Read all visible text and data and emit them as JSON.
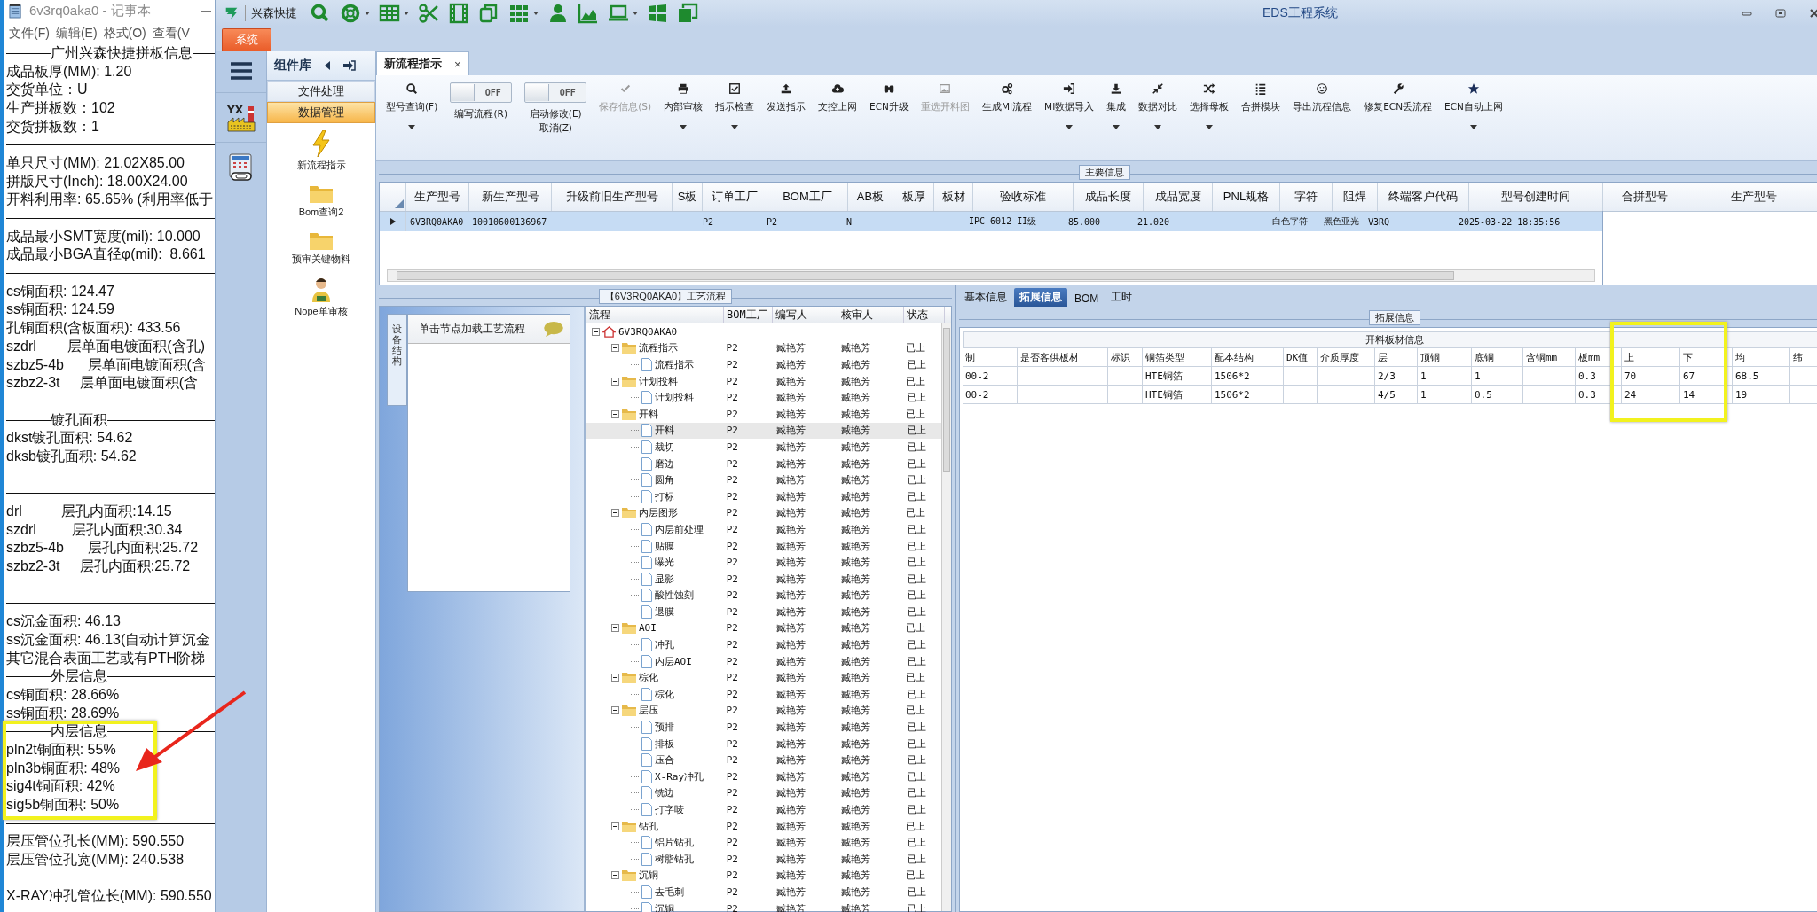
{
  "notepad": {
    "title": "6v3rq0aka0 - 记事本",
    "menu": [
      "文件(F)",
      "编辑(E)",
      "格式(O)",
      "查看(V"
    ],
    "lines": [
      {
        "kind": "rule",
        "text": "广州兴森快捷拼板信息"
      },
      {
        "kind": "text",
        "text": "成品板厚(MM): 1.20"
      },
      {
        "kind": "text",
        "text": "交货单位：U"
      },
      {
        "kind": "text",
        "text": "生产拼板数：102"
      },
      {
        "kind": "text",
        "text": "交货拼板数：1"
      },
      {
        "kind": "rule"
      },
      {
        "kind": "text",
        "text": "单只尺寸(MM): 21.02X85.00"
      },
      {
        "kind": "text",
        "text": "拼版尺寸(Inch): 18.00X24.00"
      },
      {
        "kind": "text",
        "text": "开料利用率: 65.65% (利用率低于"
      },
      {
        "kind": "rule"
      },
      {
        "kind": "text",
        "text": "成品最小SMT宽度(mil): 10.000"
      },
      {
        "kind": "text",
        "text": "成品最小BGA直径φ(mil):  8.661"
      },
      {
        "kind": "rule"
      },
      {
        "kind": "text",
        "text": "cs铜面积: 124.47"
      },
      {
        "kind": "text",
        "text": "ss铜面积: 124.59"
      },
      {
        "kind": "text",
        "text": "孔铜面积(含板面积): 433.56"
      },
      {
        "kind": "text",
        "text": "szdrl        层单面电镀面积(含孔)"
      },
      {
        "kind": "text",
        "text": "szbz5-4b      层单面电镀面积(含"
      },
      {
        "kind": "text",
        "text": "szbz2-3t     层单面电镀面积(含"
      },
      {
        "kind": "blank"
      },
      {
        "kind": "rule",
        "text": "镀孔面积"
      },
      {
        "kind": "text",
        "text": "dkst镀孔面积: 54.62"
      },
      {
        "kind": "text",
        "text": "dksb镀孔面积: 54.62"
      },
      {
        "kind": "blank"
      },
      {
        "kind": "rule"
      },
      {
        "kind": "text",
        "text": "drl          层孔内面积:14.15"
      },
      {
        "kind": "text",
        "text": "szdrl         层孔内面积:30.34"
      },
      {
        "kind": "text",
        "text": "szbz5-4b      层孔内面积:25.72"
      },
      {
        "kind": "text",
        "text": "szbz2-3t     层孔内面积:25.72"
      },
      {
        "kind": "blank"
      },
      {
        "kind": "rule"
      },
      {
        "kind": "text",
        "text": "cs沉金面积: 46.13"
      },
      {
        "kind": "text",
        "text": "ss沉金面积: 46.13(自动计算沉金"
      },
      {
        "kind": "text",
        "text": "其它混合表面工艺或有PTH阶梯"
      },
      {
        "kind": "rule",
        "text": "外层信息"
      },
      {
        "kind": "text",
        "text": "cs铜面积: 28.66%"
      },
      {
        "kind": "text",
        "text": "ss铜面积: 28.69%"
      },
      {
        "kind": "rule",
        "text": "内层信息"
      },
      {
        "kind": "text",
        "text": "pln2t铜面积: 55%"
      },
      {
        "kind": "text",
        "text": "pln3b铜面积: 48%"
      },
      {
        "kind": "text",
        "text": "sig4t铜面积: 42%"
      },
      {
        "kind": "text",
        "text": "sig5b铜面积: 50%"
      },
      {
        "kind": "rule"
      },
      {
        "kind": "text",
        "text": "层压管位孔长(MM): 590.550"
      },
      {
        "kind": "text",
        "text": "层压管位孔宽(MM): 240.538"
      },
      {
        "kind": "blank"
      },
      {
        "kind": "text",
        "text": "X-RAY冲孔管位长(MM): 590.550"
      }
    ]
  },
  "window": {
    "title": "EDS工程系统",
    "app_name": "兴森快捷",
    "menu_tab": "系统"
  },
  "side_strip": {
    "factory_label": "YX"
  },
  "component_library": {
    "title": "组件库",
    "sections": [
      {
        "label": "文件处理",
        "selected": false
      },
      {
        "label": "数据管理",
        "selected": true
      }
    ],
    "items": [
      "新流程指示",
      "Bom查询2",
      "预审关键物料",
      "Nope单审核"
    ]
  },
  "document_tab": {
    "label": "新流程指示",
    "close": "×"
  },
  "toolbar": [
    {
      "kind": "button",
      "label": "型号查询(F)",
      "disabled": false,
      "dropdown": true
    },
    {
      "kind": "toggle",
      "label": "编写流程(R)",
      "on": false,
      "state_text": "OFF"
    },
    {
      "kind": "toggle",
      "label": "启动修改(E)\n取消(Z)",
      "on": false,
      "state_text": "OFF"
    },
    {
      "kind": "button",
      "label": "保存信息(S)",
      "disabled": true,
      "dropdown": false
    },
    {
      "kind": "button",
      "label": "内部审核",
      "disabled": false,
      "dropdown": true
    },
    {
      "kind": "button",
      "label": "指示检查",
      "disabled": false,
      "dropdown": true
    },
    {
      "kind": "button",
      "label": "发送指示",
      "disabled": false,
      "dropdown": false
    },
    {
      "kind": "button",
      "label": "文控上网",
      "disabled": false,
      "dropdown": false
    },
    {
      "kind": "button",
      "label": "ECN升级",
      "disabled": false,
      "dropdown": false
    },
    {
      "kind": "button",
      "label": "重选开料图",
      "disabled": true,
      "dropdown": false
    },
    {
      "kind": "button",
      "label": "生成MI流程",
      "disabled": false,
      "dropdown": false
    },
    {
      "kind": "button",
      "label": "MI数据导入",
      "disabled": false,
      "dropdown": true
    },
    {
      "kind": "button",
      "label": "集成",
      "disabled": false,
      "dropdown": true
    },
    {
      "kind": "button",
      "label": "数据对比",
      "disabled": false,
      "dropdown": true
    },
    {
      "kind": "button",
      "label": "选择母板",
      "disabled": false,
      "dropdown": true
    },
    {
      "kind": "button",
      "label": "合拼模块",
      "disabled": false,
      "dropdown": false
    },
    {
      "kind": "button",
      "label": "导出流程信息",
      "disabled": false,
      "dropdown": false
    },
    {
      "kind": "button",
      "label": "修复ECN丢流程",
      "disabled": false,
      "dropdown": false
    },
    {
      "kind": "button",
      "label": "ECN自动上网",
      "disabled": false,
      "dropdown": true
    }
  ],
  "main_info": {
    "title": "主要信息",
    "columns": [
      "生产型号",
      "新生产型号",
      "升级前旧生产型号",
      "S板",
      "订单工厂",
      "BOM工厂",
      "AB板",
      "板厚",
      "板材",
      "验收标准",
      "成品长度",
      "成品宽度",
      "PNL规格",
      "字符",
      "阻焊",
      "终端客户代码",
      "型号创建时间"
    ],
    "rows": [
      {
        "selected": true,
        "cells": [
          "6V3RQ0AKA0",
          "10010600136967",
          "",
          "",
          "P2",
          "P2",
          "N",
          "",
          "",
          "IPC-6012 II级",
          "85.000",
          "21.020",
          "",
          "白色字符",
          "黑色亚光",
          "V3RQ",
          "2025-03-22 18:35:56"
        ]
      }
    ],
    "side_columns": [
      "合拼型号",
      "生产型号"
    ]
  },
  "process": {
    "title": "【6V3RQ0AKA0】工艺流程",
    "side_tab": "设备结构",
    "hint": "单击节点加载工艺流程",
    "columns": [
      "流程",
      "BOM工厂",
      "编写人",
      "核审人",
      "状态"
    ],
    "tree": [
      {
        "label": "6V3RQ0AKA0",
        "kind": "root",
        "expanded": true,
        "selected": false,
        "children": [
          {
            "label": "流程指示",
            "kind": "group",
            "expanded": true,
            "selected": false,
            "bom": "P2",
            "writer": "臧艳芳",
            "reviewer": "臧艳芳",
            "status": "已上",
            "children": [
              {
                "label": "流程指示",
                "kind": "step",
                "selected": false,
                "bom": "P2",
                "writer": "臧艳芳",
                "reviewer": "臧艳芳",
                "status": "已上"
              }
            ]
          },
          {
            "label": "计划投料",
            "kind": "group",
            "expanded": true,
            "selected": false,
            "bom": "P2",
            "writer": "臧艳芳",
            "reviewer": "臧艳芳",
            "status": "已上",
            "children": [
              {
                "label": "计划投料",
                "kind": "step",
                "selected": false,
                "bom": "P2",
                "writer": "臧艳芳",
                "reviewer": "臧艳芳",
                "status": "已上"
              }
            ]
          },
          {
            "label": "开料",
            "kind": "group",
            "expanded": true,
            "selected": false,
            "bom": "P2",
            "writer": "臧艳芳",
            "reviewer": "臧艳芳",
            "status": "已上",
            "children": [
              {
                "label": "开料",
                "kind": "step",
                "selected": true,
                "bom": "P2",
                "writer": "臧艳芳",
                "reviewer": "臧艳芳",
                "status": "已上"
              },
              {
                "label": "裁切",
                "kind": "step",
                "selected": false,
                "bom": "P2",
                "writer": "臧艳芳",
                "reviewer": "臧艳芳",
                "status": "已上"
              },
              {
                "label": "磨边",
                "kind": "step",
                "selected": false,
                "bom": "P2",
                "writer": "臧艳芳",
                "reviewer": "臧艳芳",
                "status": "已上"
              },
              {
                "label": "圆角",
                "kind": "step",
                "selected": false,
                "bom": "P2",
                "writer": "臧艳芳",
                "reviewer": "臧艳芳",
                "status": "已上"
              },
              {
                "label": "打标",
                "kind": "step",
                "selected": false,
                "bom": "P2",
                "writer": "臧艳芳",
                "reviewer": "臧艳芳",
                "status": "已上"
              }
            ]
          },
          {
            "label": "内层图形",
            "kind": "group",
            "expanded": true,
            "selected": false,
            "bom": "P2",
            "writer": "臧艳芳",
            "reviewer": "臧艳芳",
            "status": "已上",
            "children": [
              {
                "label": "内层前处理",
                "kind": "step",
                "selected": false,
                "bom": "P2",
                "writer": "臧艳芳",
                "reviewer": "臧艳芳",
                "status": "已上"
              },
              {
                "label": "贴膜",
                "kind": "step",
                "selected": false,
                "bom": "P2",
                "writer": "臧艳芳",
                "reviewer": "臧艳芳",
                "status": "已上"
              },
              {
                "label": "曝光",
                "kind": "step",
                "selected": false,
                "bom": "P2",
                "writer": "臧艳芳",
                "reviewer": "臧艳芳",
                "status": "已上"
              },
              {
                "label": "显影",
                "kind": "step",
                "selected": false,
                "bom": "P2",
                "writer": "臧艳芳",
                "reviewer": "臧艳芳",
                "status": "已上"
              },
              {
                "label": "酸性蚀刻",
                "kind": "step",
                "selected": false,
                "bom": "P2",
                "writer": "臧艳芳",
                "reviewer": "臧艳芳",
                "status": "已上"
              },
              {
                "label": "退膜",
                "kind": "step",
                "selected": false,
                "bom": "P2",
                "writer": "臧艳芳",
                "reviewer": "臧艳芳",
                "status": "已上"
              }
            ]
          },
          {
            "label": "AOI",
            "kind": "group",
            "expanded": true,
            "selected": false,
            "bom": "P2",
            "writer": "臧艳芳",
            "reviewer": "臧艳芳",
            "status": "已上",
            "children": [
              {
                "label": "冲孔",
                "kind": "step",
                "selected": false,
                "bom": "P2",
                "writer": "臧艳芳",
                "reviewer": "臧艳芳",
                "status": "已上"
              },
              {
                "label": "内层AOI",
                "kind": "step",
                "selected": false,
                "bom": "P2",
                "writer": "臧艳芳",
                "reviewer": "臧艳芳",
                "status": "已上"
              }
            ]
          },
          {
            "label": "棕化",
            "kind": "group",
            "expanded": true,
            "selected": false,
            "bom": "P2",
            "writer": "臧艳芳",
            "reviewer": "臧艳芳",
            "status": "已上",
            "children": [
              {
                "label": "棕化",
                "kind": "step",
                "selected": false,
                "bom": "P2",
                "writer": "臧艳芳",
                "reviewer": "臧艳芳",
                "status": "已上"
              }
            ]
          },
          {
            "label": "层压",
            "kind": "group",
            "expanded": true,
            "selected": false,
            "bom": "P2",
            "writer": "臧艳芳",
            "reviewer": "臧艳芳",
            "status": "已上",
            "children": [
              {
                "label": "预排",
                "kind": "step",
                "selected": false,
                "bom": "P2",
                "writer": "臧艳芳",
                "reviewer": "臧艳芳",
                "status": "已上"
              },
              {
                "label": "排板",
                "kind": "step",
                "selected": false,
                "bom": "P2",
                "writer": "臧艳芳",
                "reviewer": "臧艳芳",
                "status": "已上"
              },
              {
                "label": "压合",
                "kind": "step",
                "selected": false,
                "bom": "P2",
                "writer": "臧艳芳",
                "reviewer": "臧艳芳",
                "status": "已上"
              },
              {
                "label": "X-Ray冲孔",
                "kind": "step",
                "selected": false,
                "bom": "P2",
                "writer": "臧艳芳",
                "reviewer": "臧艳芳",
                "status": "已上"
              },
              {
                "label": "铣边",
                "kind": "step",
                "selected": false,
                "bom": "P2",
                "writer": "臧艳芳",
                "reviewer": "臧艳芳",
                "status": "已上"
              },
              {
                "label": "打字唛",
                "kind": "step",
                "selected": false,
                "bom": "P2",
                "writer": "臧艳芳",
                "reviewer": "臧艳芳",
                "status": "已上"
              }
            ]
          },
          {
            "label": "钻孔",
            "kind": "group",
            "expanded": true,
            "selected": false,
            "bom": "P2",
            "writer": "臧艳芳",
            "reviewer": "臧艳芳",
            "status": "已上",
            "children": [
              {
                "label": "铝片钻孔",
                "kind": "step",
                "selected": false,
                "bom": "P2",
                "writer": "臧艳芳",
                "reviewer": "臧艳芳",
                "status": "已上"
              },
              {
                "label": "树脂钻孔",
                "kind": "step",
                "selected": false,
                "bom": "P2",
                "writer": "臧艳芳",
                "reviewer": "臧艳芳",
                "status": "已上"
              }
            ]
          },
          {
            "label": "沉铜",
            "kind": "group",
            "expanded": true,
            "selected": false,
            "bom": "P2",
            "writer": "臧艳芳",
            "reviewer": "臧艳芳",
            "status": "已上",
            "children": [
              {
                "label": "去毛刺",
                "kind": "step",
                "selected": false,
                "bom": "P2",
                "writer": "臧艳芳",
                "reviewer": "臧艳芳",
                "status": "已上"
              },
              {
                "label": "沉铜",
                "kind": "step",
                "selected": false,
                "bom": "P2",
                "writer": "臧艳芳",
                "reviewer": "臧艳芳",
                "status": "已上"
              }
            ]
          }
        ]
      }
    ]
  },
  "detail": {
    "tabs": [
      {
        "label": "基本信息",
        "selected": false
      },
      {
        "label": "拓展信息",
        "selected": true
      },
      {
        "label": "BOM",
        "selected": false
      },
      {
        "label": "工时",
        "selected": false
      }
    ],
    "group_title": "拓展信息",
    "table_title": "开料板材信息",
    "columns": [
      "制",
      "是否客供板材",
      "标识",
      "铜箔类型",
      "配本结构",
      "DK值",
      "介质厚度",
      "层",
      "顶铜",
      "底铜",
      "含铜mm",
      "板mm",
      "上",
      "下",
      "均",
      "纬"
    ],
    "rows": [
      [
        "00-2",
        "",
        "",
        "HTE铜箔",
        "1506*2",
        "",
        "",
        "2/3",
        "1",
        "1",
        "",
        "0.3",
        "70",
        "67",
        "68.5",
        ""
      ],
      [
        "00-2",
        "",
        "",
        "HTE铜箔",
        "1506*2",
        "",
        "",
        "4/5",
        "1",
        "0.5",
        "",
        "0.3",
        "24",
        "14",
        "19",
        ""
      ]
    ]
  },
  "annotations": [
    {
      "kind": "highlight"
    },
    {
      "kind": "highlight"
    },
    {
      "kind": "arrow"
    }
  ]
}
